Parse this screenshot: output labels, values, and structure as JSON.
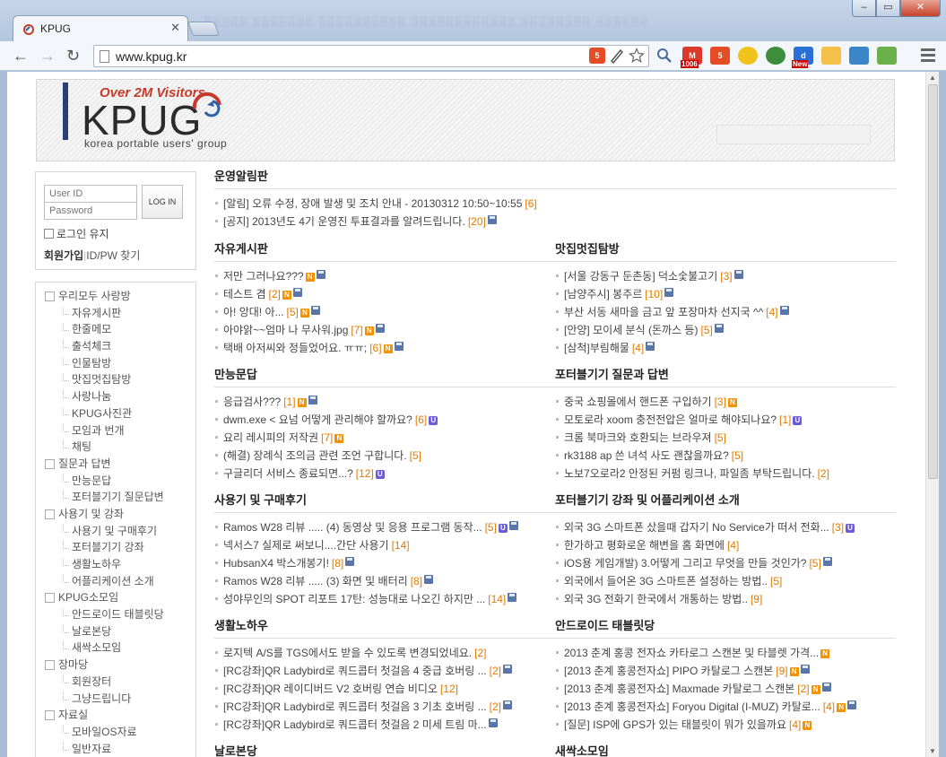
{
  "browser": {
    "tab_title": "KPUG",
    "tab_close": "✕",
    "url": "www.kpug.kr",
    "back": "←",
    "forward": "→",
    "reload": "↻",
    "win_min": "–",
    "win_max": "▭",
    "win_close": "✕",
    "gmail_count": "1006",
    "new_badge": "New"
  },
  "banner": {
    "over_text": "Over 2M Visitors",
    "logo": "KPUG",
    "subtitle": "korea portable users' group"
  },
  "login": {
    "user_placeholder": "User ID",
    "pass_placeholder": "Password",
    "button": "LOG IN",
    "remember": "로그인 유지",
    "join": "회원가입",
    "find": "ID/PW 찾기"
  },
  "nav": [
    {
      "label": "우리모두 사랑방",
      "level": "cat"
    },
    {
      "label": "자유게시판",
      "level": "sub"
    },
    {
      "label": "한줄메모",
      "level": "sub"
    },
    {
      "label": "출석체크",
      "level": "sub"
    },
    {
      "label": "인물탐방",
      "level": "sub"
    },
    {
      "label": "맛집멋집탐방",
      "level": "sub"
    },
    {
      "label": "사랑나눔",
      "level": "sub"
    },
    {
      "label": "KPUG사진관",
      "level": "sub"
    },
    {
      "label": "모임과 번개",
      "level": "sub"
    },
    {
      "label": "채팅",
      "level": "sub"
    },
    {
      "label": "질문과 답변",
      "level": "cat"
    },
    {
      "label": "만능문답",
      "level": "sub"
    },
    {
      "label": "포터블기기 질문답변",
      "level": "sub"
    },
    {
      "label": "사용기 및 강좌",
      "level": "cat"
    },
    {
      "label": "사용기 및 구매후기",
      "level": "sub"
    },
    {
      "label": "포터블기기 강좌",
      "level": "sub"
    },
    {
      "label": "생활노하우",
      "level": "sub"
    },
    {
      "label": "어플리케이션 소개",
      "level": "sub"
    },
    {
      "label": "KPUG소모임",
      "level": "cat"
    },
    {
      "label": "안드로이드 태블릿당",
      "level": "sub"
    },
    {
      "label": "날로본당",
      "level": "sub"
    },
    {
      "label": "새싹소모임",
      "level": "sub"
    },
    {
      "label": "장마당",
      "level": "cat"
    },
    {
      "label": "회원장터",
      "level": "sub"
    },
    {
      "label": "그냥드립니다",
      "level": "sub"
    },
    {
      "label": "자료실",
      "level": "cat"
    },
    {
      "label": "모바일OS자료",
      "level": "sub"
    },
    {
      "label": "일반자료",
      "level": "sub"
    }
  ],
  "sections": {
    "notice": {
      "title": "운영알림판",
      "posts": [
        {
          "text": "[알림] 오류 수정, 장애 발생 및 조치 안내 - 20130312 10:50~10:55",
          "count": "[6]",
          "badges": []
        },
        {
          "text": "[공지] 2013년도 4기 운영진 투표결과를 알려드립니다.",
          "count": "[20]",
          "badges": [
            "d"
          ]
        }
      ]
    },
    "free": {
      "title": "자유게시판",
      "posts": [
        {
          "text": "저만 그러나요???",
          "count": "",
          "badges": [
            "n",
            "d"
          ]
        },
        {
          "text": "테스트 겸",
          "count": "[2]",
          "badges": [
            "n",
            "d"
          ]
        },
        {
          "text": "아! 앙대! 아...",
          "count": "[5]",
          "badges": [
            "n",
            "d"
          ]
        },
        {
          "text": "아야앍~~엄마 나 무사워.jpg",
          "count": "[7]",
          "badges": [
            "n",
            "d"
          ]
        },
        {
          "text": "택배 아저씨와 정들었어요. ㅠㅠ;",
          "count": "[6]",
          "badges": [
            "n",
            "d"
          ]
        }
      ]
    },
    "food": {
      "title": "맛집멋집탐방",
      "posts": [
        {
          "text": "[서울 강동구 둔촌동] 덕소숯불고기",
          "count": "[3]",
          "badges": [
            "d"
          ]
        },
        {
          "text": "[남양주시] 봉주르",
          "count": "[10]",
          "badges": [
            "d"
          ]
        },
        {
          "text": "부산 서동 새마을 금고 앞 포장마차 선지국 ^^",
          "count": "[4]",
          "badges": [
            "d"
          ]
        },
        {
          "text": "[안양] 모이세 분식 (돈까스 등)",
          "count": "[5]",
          "badges": [
            "d"
          ]
        },
        {
          "text": "[삼척]부림해물",
          "count": "[4]",
          "badges": [
            "d"
          ]
        }
      ]
    },
    "qa": {
      "title": "만능문답",
      "posts": [
        {
          "text": "응급검사???",
          "count": "[1]",
          "badges": [
            "n",
            "d"
          ]
        },
        {
          "text": "dwm.exe < 요넘 어떻게 관리해야 할까요?",
          "count": "[6]",
          "badges": [
            "u"
          ]
        },
        {
          "text": "요리 레시피의 저작권",
          "count": "[7]",
          "badges": [
            "n"
          ]
        },
        {
          "text": "(해결) 장례식 조의금 관련 조언 구합니다.",
          "count": "[5]",
          "badges": []
        },
        {
          "text": "구글리더 서비스 종료되면...?",
          "count": "[12]",
          "badges": [
            "u"
          ]
        }
      ]
    },
    "portable_qa": {
      "title": "포터블기기 질문과 답변",
      "posts": [
        {
          "text": "중국 쇼핑몰에서 핸드폰 구입하기",
          "count": "[3]",
          "badges": [
            "n"
          ]
        },
        {
          "text": "모토로라 xoom 충전전압은 얼마로 해야되나요?",
          "count": "[1]",
          "badges": [
            "u"
          ]
        },
        {
          "text": "크롬 북마크와 호환되는 브라우져",
          "count": "[5]",
          "badges": []
        },
        {
          "text": "rk3188 ap 쓴 녀석 사도 괜찮을까요?",
          "count": "[5]",
          "badges": []
        },
        {
          "text": "노보7오로라2 안정된 커펌 링크나, 파일좀 부탁드립니다.",
          "count": "[2]",
          "badges": []
        }
      ]
    },
    "reviews": {
      "title": "사용기 및 구매후기",
      "posts": [
        {
          "text": "Ramos W28 리뷰 ..... (4) 동영상 및 응용 프로그램 동작...",
          "count": "[5]",
          "badges": [
            "u",
            "d"
          ]
        },
        {
          "text": "넥서스7 실제로 써보니....간단 사용기",
          "count": "[14]",
          "badges": []
        },
        {
          "text": "HubsanX4 박스개봉기!",
          "count": "[8]",
          "badges": [
            "d"
          ]
        },
        {
          "text": "Ramos W28 리뷰 ..... (3) 화면 및 배터리",
          "count": "[8]",
          "badges": [
            "d"
          ]
        },
        {
          "text": "성야무인의 SPOT 리포트 17탄: 성능대로 나오긴 하지만 ...",
          "count": "[14]",
          "badges": [
            "d"
          ]
        }
      ]
    },
    "apps": {
      "title": "포터블기기 강좌 및 어플리케이션 소개",
      "posts": [
        {
          "text": "외국 3G 스마트폰 샀을때 갑자기 No Service가 떠서 전화...",
          "count": "[3]",
          "badges": [
            "u"
          ]
        },
        {
          "text": "한가하고 평화로운 해변을 홈 화면에",
          "count": "[4]",
          "badges": []
        },
        {
          "text": "iOS용 게임개발) 3.어떻게 그리고 무엇을 만들 것인가?",
          "count": "[5]",
          "badges": [
            "d"
          ]
        },
        {
          "text": "외국에서 들어온 3G 스마트폰 설정하는 방법..",
          "count": "[5]",
          "badges": []
        },
        {
          "text": "외국 3G 전화기 한국에서 개통하는 방법..",
          "count": "[9]",
          "badges": []
        }
      ]
    },
    "tips": {
      "title": "생활노하우",
      "posts": [
        {
          "text": "로지텍 A/S를 TGS에서도 받을 수 있도록 변경되었네요.",
          "count": "[2]",
          "badges": []
        },
        {
          "text": "[RC강좌]QR Ladybird로 쿼드콥터 첫걸음 4 중급 호버링 ...",
          "count": "[2]",
          "badges": [
            "d"
          ]
        },
        {
          "text": "[RC강좌]QR 레이디버드 V2 호버링 연습 비디오",
          "count": "[12]",
          "badges": []
        },
        {
          "text": "[RC강좌]QR Ladybird로 쿼드콥터 첫걸음 3 기초 호버링 ...",
          "count": "[2]",
          "badges": [
            "d"
          ]
        },
        {
          "text": "[RC강좌]QR Ladybird로 쿼드콥터 첫걸음 2 미세 트림 마...",
          "count": "",
          "badges": [
            "d"
          ]
        }
      ]
    },
    "android": {
      "title": "안드로이드 태블릿당",
      "posts": [
        {
          "text": "2013 춘계 홍콩 전자쇼 카타로그 스캔본 및 타블렛 가격...",
          "count": "",
          "badges": [
            "n"
          ]
        },
        {
          "text": "[2013 춘계 홍콩전자쇼] PIPO 카탈로그 스캔본",
          "count": "[9]",
          "badges": [
            "n",
            "d"
          ]
        },
        {
          "text": "[2013 춘계 홍콩전자쇼] Maxmade 카탈로그 스캔본",
          "count": "[2]",
          "badges": [
            "n",
            "d"
          ]
        },
        {
          "text": "[2013 춘계 홍콩전자쇼] Foryou Digital (I-MUZ) 카탈로...",
          "count": "[4]",
          "badges": [
            "n",
            "d"
          ]
        },
        {
          "text": "[질문] ISP에 GPS가 있는 태블릿이 뭐가 있을까요",
          "count": "[4]",
          "badges": [
            "n"
          ]
        }
      ]
    },
    "cut1": {
      "title": "날로본당"
    },
    "cut2": {
      "title": "새싹소모임"
    }
  }
}
